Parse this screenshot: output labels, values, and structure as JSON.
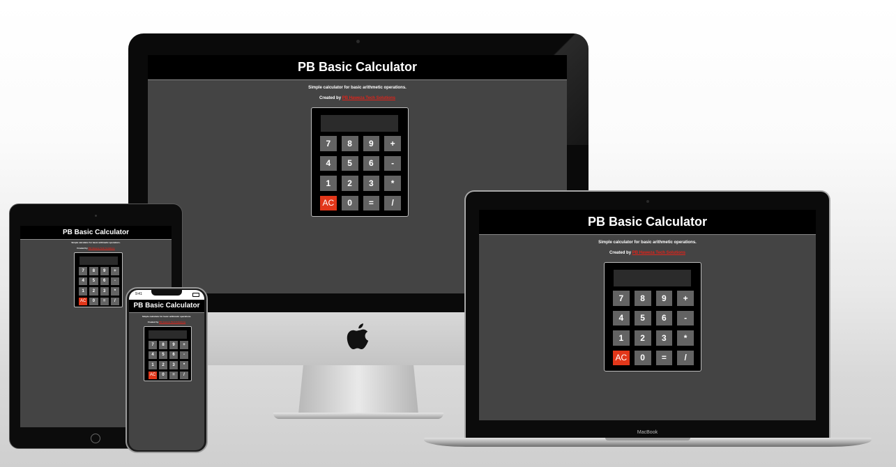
{
  "app": {
    "title": "PB Basic Calculator",
    "subtitle": "Simple calculator for basic arithmetic operations.",
    "credit_prefix": "Created by",
    "credit_link": "PB Haweza Tech Solutions"
  },
  "keys": [
    {
      "label": "7",
      "type": "digit"
    },
    {
      "label": "8",
      "type": "digit"
    },
    {
      "label": "9",
      "type": "digit"
    },
    {
      "label": "+",
      "type": "op"
    },
    {
      "label": "4",
      "type": "digit"
    },
    {
      "label": "5",
      "type": "digit"
    },
    {
      "label": "6",
      "type": "digit"
    },
    {
      "label": "-",
      "type": "op"
    },
    {
      "label": "1",
      "type": "digit"
    },
    {
      "label": "2",
      "type": "digit"
    },
    {
      "label": "3",
      "type": "digit"
    },
    {
      "label": "*",
      "type": "op"
    },
    {
      "label": "AC",
      "type": "clear"
    },
    {
      "label": "0",
      "type": "digit"
    },
    {
      "label": "=",
      "type": "equals"
    },
    {
      "label": "/",
      "type": "op"
    }
  ],
  "phone_status": {
    "time": "9:41"
  },
  "laptop": {
    "brand_label": "MacBook"
  },
  "colors": {
    "screen_bg": "#444444",
    "header_bg": "#000000",
    "key_bg": "#636363",
    "clear_key": "#e2371a",
    "link": "#e0231a"
  }
}
